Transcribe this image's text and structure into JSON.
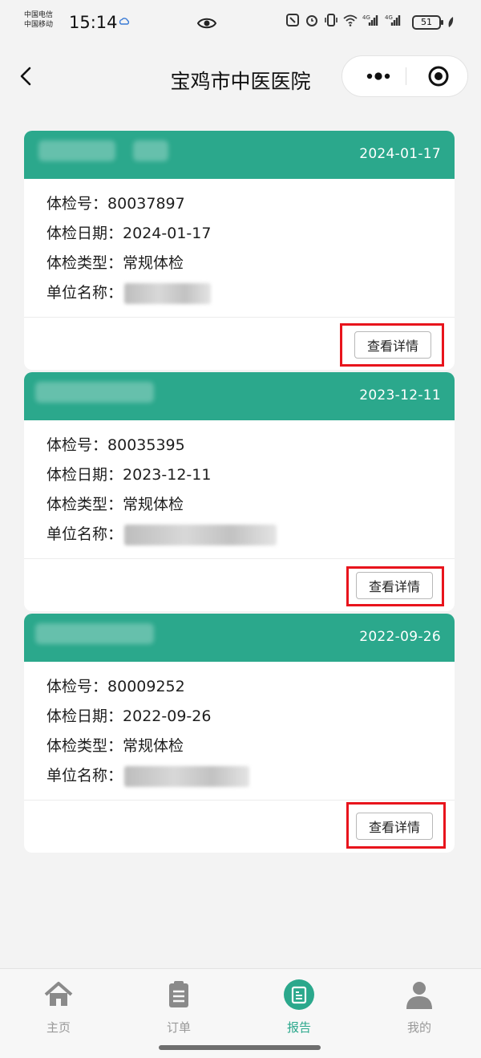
{
  "status_bar": {
    "carrier_1": "中国电信",
    "carrier_2": "中国移动",
    "time": "15:14",
    "battery": "51"
  },
  "nav": {
    "title": "宝鸡市中医医院"
  },
  "labels": {
    "exam_number": "体检号：",
    "exam_date": "体检日期：",
    "exam_type": "体检类型：",
    "unit_name": "单位名称："
  },
  "reports": [
    {
      "date": "2024-01-17",
      "exam_number": "80037897",
      "exam_date": "2024-01-17",
      "exam_type": "常规体检",
      "detail_label": "查看详情"
    },
    {
      "date": "2023-12-11",
      "exam_number": "80035395",
      "exam_date": "2023-12-11",
      "exam_type": "常规体检",
      "detail_label": "查看详情"
    },
    {
      "date": "2022-09-26",
      "exam_number": "80009252",
      "exam_date": "2022-09-26",
      "exam_type": "常规体检",
      "detail_label": "查看详情"
    }
  ],
  "tabs": [
    {
      "label": "主页",
      "icon": "home-icon"
    },
    {
      "label": "订单",
      "icon": "clipboard-icon"
    },
    {
      "label": "报告",
      "icon": "report-icon"
    },
    {
      "label": "我的",
      "icon": "person-icon"
    }
  ],
  "colors": {
    "accent": "#2ba88c",
    "highlight": "#e8141c"
  }
}
